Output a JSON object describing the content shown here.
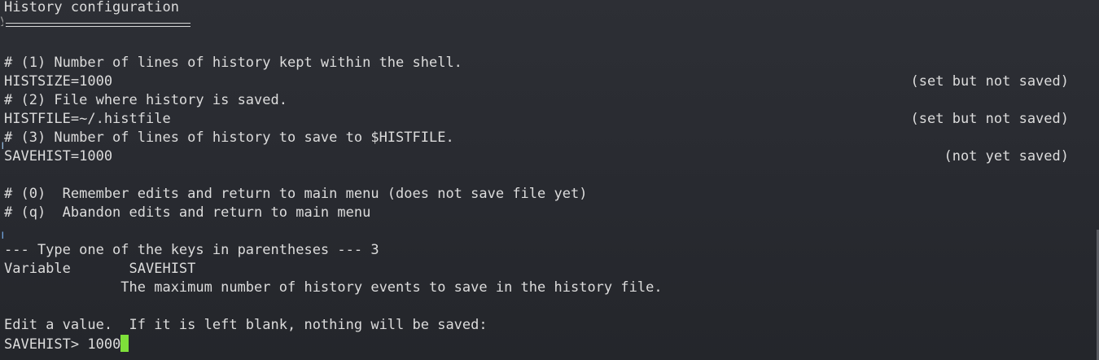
{
  "terminal": {
    "title": "History configuration",
    "lines": [
      "# (1) Number of lines of history kept within the shell.",
      "HISTSIZE=1000",
      "# (2) File where history is saved.",
      "HISTFILE=~/.histfile",
      "# (3) Number of lines of history to save to $HISTFILE.",
      "SAVEHIST=1000",
      "# (0)  Remember edits and return to main menu (does not save file yet)",
      "# (q)  Abandon edits and return to main menu",
      "--- Type one of the keys in parentheses --- 3",
      "Variable       SAVEHIST",
      "              The maximum number of history events to save in the history file.",
      "Edit a value.  If it is left blank, nothing will be saved:"
    ],
    "statuses": {
      "histsize": "(set but not saved)",
      "histfile": "(set but not saved)",
      "savehist": "(not yet saved)"
    },
    "prompt": {
      "label": "SAVEHIST> ",
      "value": "1000"
    },
    "cursor_color": "#7ee03a",
    "background_color": "#2a2c32",
    "text_color": "#dcdcdc"
  }
}
